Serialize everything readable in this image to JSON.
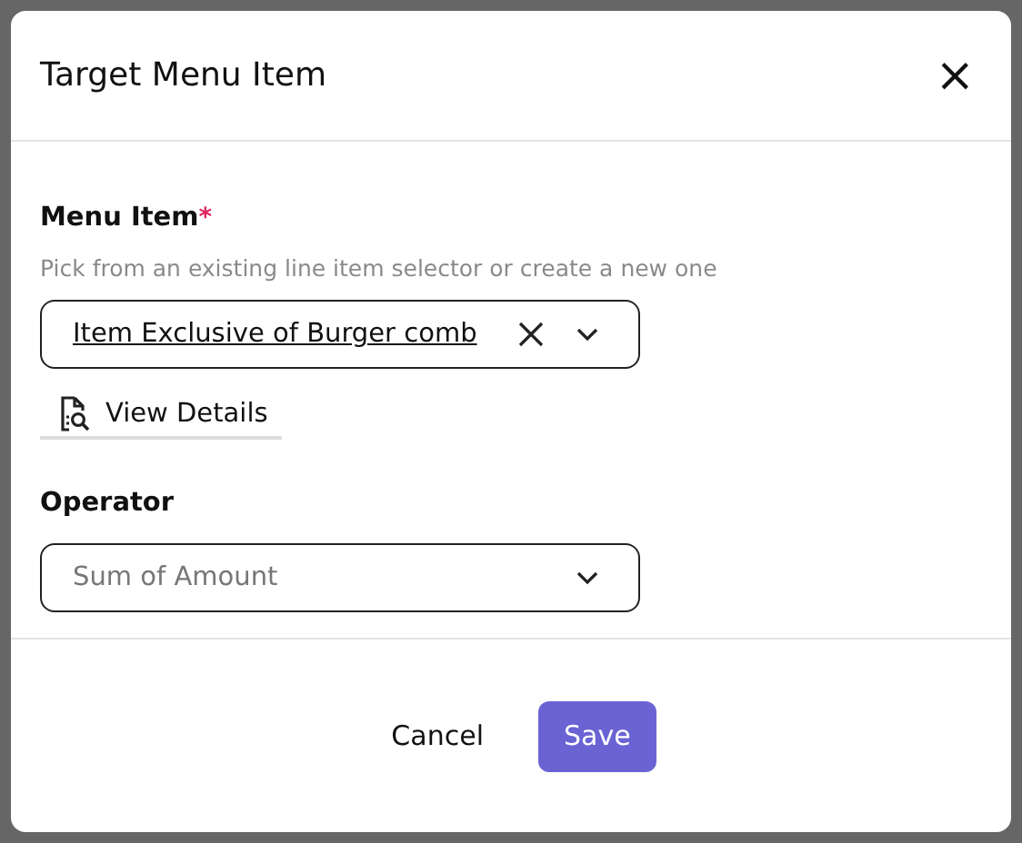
{
  "dialog": {
    "title": "Target Menu Item",
    "close_icon": "×"
  },
  "menu_item": {
    "label": "Menu Item",
    "required": true,
    "required_mark": "*",
    "hint": "Pick from an existing line item selector or create a new one",
    "value": "Item Exclusive of Burger comb",
    "details_link": "View Details"
  },
  "operator": {
    "label": "Operator",
    "placeholder": "Sum of Amount"
  },
  "buttons": [
    {
      "kind": "secondary",
      "label": "Cancel"
    },
    {
      "kind": "primary",
      "label": "Save"
    }
  ]
}
